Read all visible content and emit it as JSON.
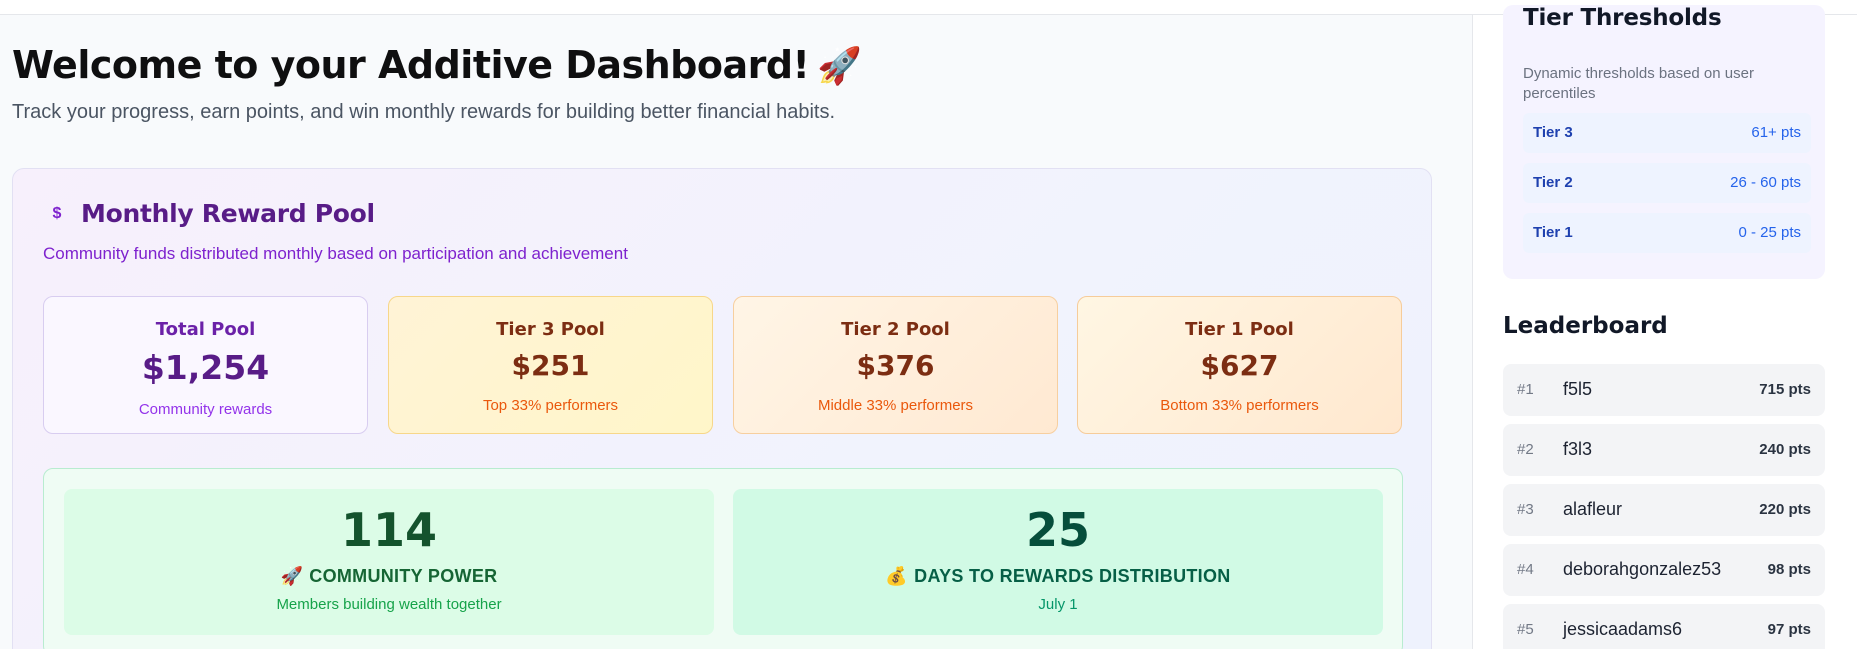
{
  "header": {
    "title": "Welcome to your Additive Dashboard!",
    "title_emoji": "🚀",
    "subtitle": "Track your progress, earn points, and win monthly rewards for building better financial habits."
  },
  "reward_pool": {
    "icon": "dollar-icon",
    "icon_glyph": "$",
    "title": "Monthly Reward Pool",
    "description": "Community funds distributed monthly based on participation and achievement",
    "tiles": [
      {
        "label": "Total Pool",
        "value": "$1,254",
        "sub": "Community rewards"
      },
      {
        "label": "Tier 3 Pool",
        "value": "$251",
        "sub": "Top 33% performers"
      },
      {
        "label": "Tier 2 Pool",
        "value": "$376",
        "sub": "Middle 33% performers"
      },
      {
        "label": "Tier 1 Pool",
        "value": "$627",
        "sub": "Bottom 33% performers"
      }
    ],
    "community": {
      "power_value": "114",
      "power_emoji": "🚀",
      "power_label": "COMMUNITY POWER",
      "power_sub": "Members building wealth together",
      "days_value": "25",
      "days_emoji": "💰",
      "days_label": "DAYS TO REWARDS DISTRIBUTION",
      "days_sub": "July 1"
    }
  },
  "sidebar": {
    "thresholds": {
      "title": "Tier Thresholds",
      "description": "Dynamic thresholds based on user percentiles",
      "rows": [
        {
          "name": "Tier 3",
          "range": "61+ pts"
        },
        {
          "name": "Tier 2",
          "range": "26 - 60 pts"
        },
        {
          "name": "Tier 1",
          "range": "0 - 25 pts"
        }
      ]
    },
    "leaderboard": {
      "title": "Leaderboard",
      "rows": [
        {
          "rank": "#1",
          "user": "f5l5",
          "points": "715 pts"
        },
        {
          "rank": "#2",
          "user": "f3l3",
          "points": "240 pts"
        },
        {
          "rank": "#3",
          "user": "alafleur",
          "points": "220 pts"
        },
        {
          "rank": "#4",
          "user": "deborahgonzalez53",
          "points": "98 pts"
        },
        {
          "rank": "#5",
          "user": "jessicaadams6",
          "points": "97 pts"
        }
      ]
    }
  },
  "colors": {
    "pool_title": "#581c87",
    "tier_text": "#7c2d12",
    "community_green": "#14532d",
    "threshold_blue": "#1e40af"
  }
}
